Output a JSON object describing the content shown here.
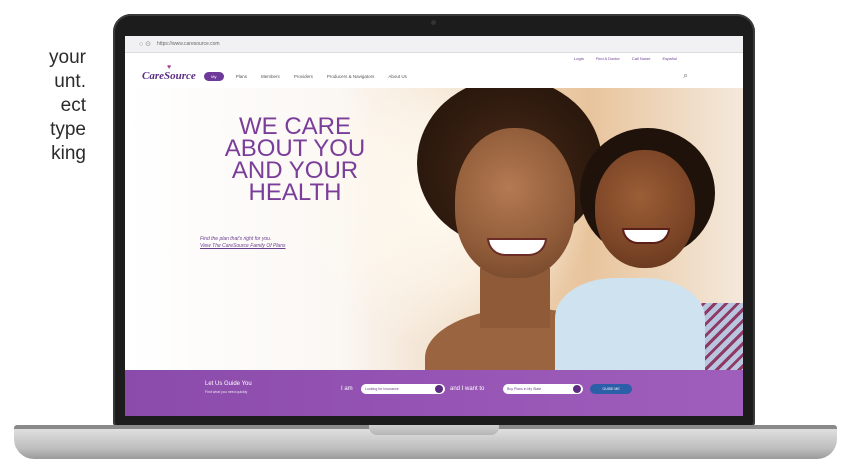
{
  "side_text": [
    "your",
    "unt.",
    "ect",
    "type",
    "king"
  ],
  "browser": {
    "url": "https://www.caresource.com",
    "nav_icons": "○ ⊙"
  },
  "util_links": [
    "Login",
    "Find A Doctor",
    "Call Nurse",
    "Español"
  ],
  "site_nav": {
    "logo": "CareSource",
    "my_button": "My",
    "items": [
      "Plans",
      "Members",
      "Providers",
      "Producers & Navigators",
      "About Us"
    ]
  },
  "hero": {
    "headline": [
      "WE CARE",
      "ABOUT YOU",
      "AND YOUR",
      "HEALTH"
    ],
    "sub_text": "Find the plan that's right for you.",
    "sub_link": "View The CareSource Family Of Plans"
  },
  "guide": {
    "title": "Let Us Guide You",
    "subtitle": "Find what you need quickly",
    "i_am_label": "I am",
    "i_am_value": "Looking for Insurance",
    "want_label": "and I want to",
    "want_value": "Buy Plans in My State",
    "button": "GUIDE ME"
  },
  "colors": {
    "brand_purple": "#7a3e9a",
    "bar_purple": "#8b4bab",
    "button_blue": "#2b5fa8"
  }
}
